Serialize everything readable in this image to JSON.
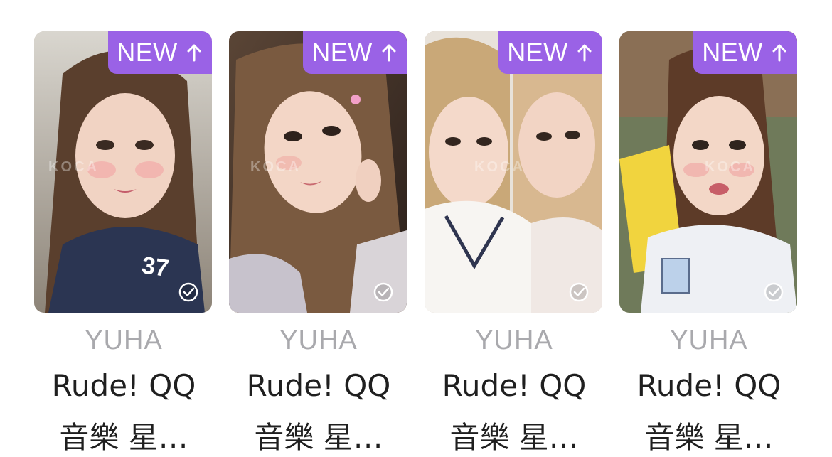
{
  "colors": {
    "badge": "#9a62e6",
    "artist_text": "#a9a9ad",
    "title_text": "#1f1f1f",
    "background": "#ffffff"
  },
  "watermark": "KOCA",
  "cards": [
    {
      "badge": "NEW",
      "artist": "YUHA",
      "title_line1": "Rude! QQ",
      "title_line2": "音樂 星…",
      "icons": [
        "arrow-up-icon",
        "check-circle-icon"
      ]
    },
    {
      "badge": "NEW",
      "artist": "YUHA",
      "title_line1": "Rude! QQ",
      "title_line2": "音樂 星…",
      "icons": [
        "arrow-up-icon",
        "check-circle-icon"
      ]
    },
    {
      "badge": "NEW",
      "artist": "YUHA",
      "title_line1": "Rude! QQ",
      "title_line2": "音樂 星…",
      "icons": [
        "arrow-up-icon",
        "check-circle-icon"
      ]
    },
    {
      "badge": "NEW",
      "artist": "YUHA",
      "title_line1": "Rude! QQ",
      "title_line2": "音樂 星…",
      "icons": [
        "arrow-up-icon",
        "check-circle-icon"
      ]
    }
  ]
}
